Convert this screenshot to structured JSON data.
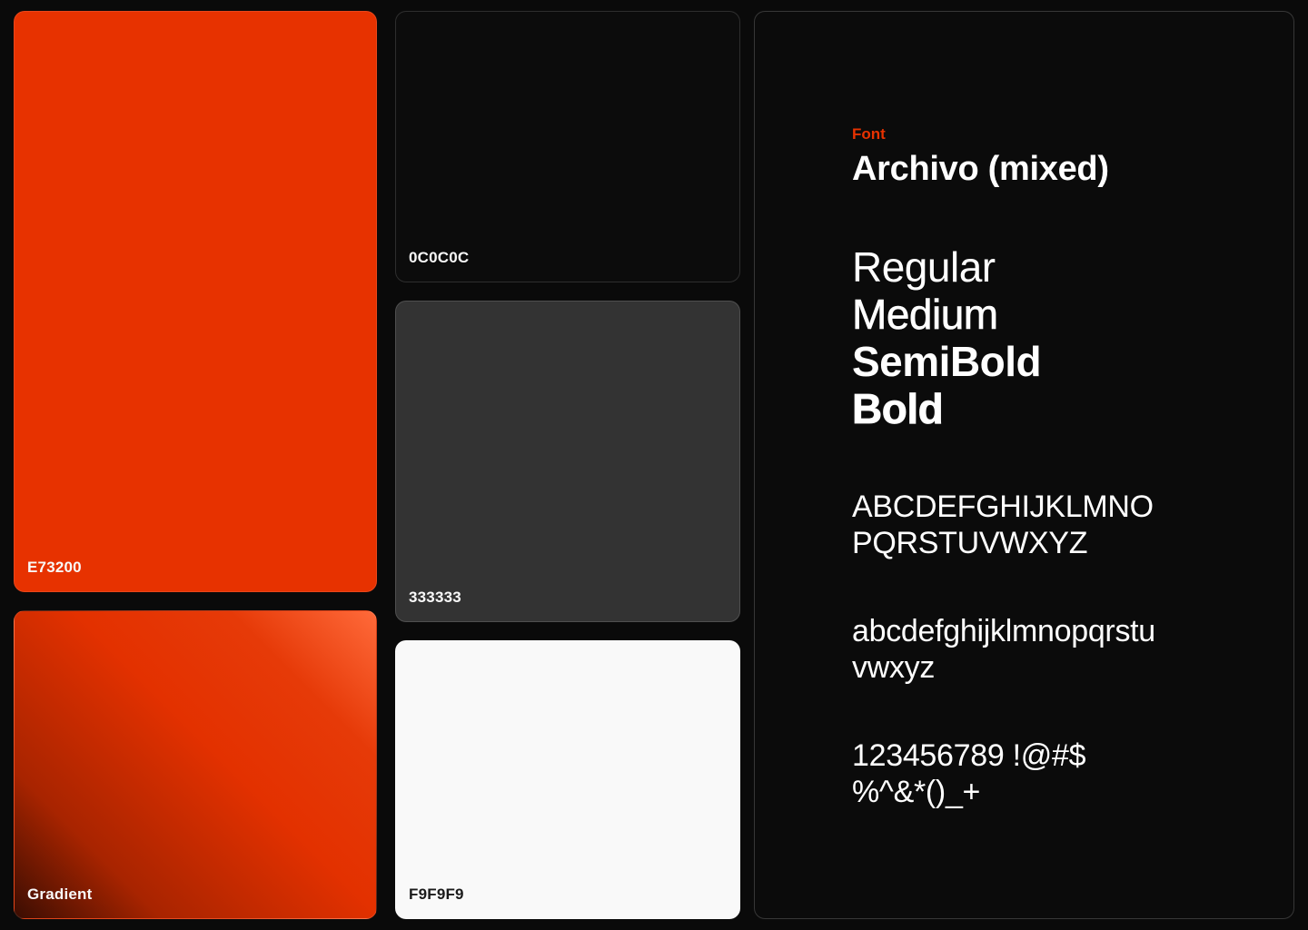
{
  "swatches": {
    "orange": {
      "label": "E73200",
      "color": "#e73200"
    },
    "gradient": {
      "label": "Gradient"
    },
    "black": {
      "label": "0C0C0C",
      "color": "#0c0c0c"
    },
    "gray": {
      "label": "333333",
      "color": "#333333"
    },
    "white": {
      "label": "F9F9F9",
      "color": "#f9f9f9"
    }
  },
  "font": {
    "caption": "Font",
    "name": "Archivo (mixed)",
    "weights": [
      "Regular",
      "Medium",
      "SemiBold",
      "Bold"
    ],
    "uppercase": [
      "ABCDEFGHIJKLMNO",
      "PQRSTUVWXYZ"
    ],
    "lowercase": [
      "abcdefghijklmnopqrstu",
      "vwxyz"
    ],
    "numerals": [
      "123456789 !@#$",
      "%^&*()_+"
    ]
  },
  "colors": {
    "accent": "#e73200",
    "background": "#0a0a0a"
  }
}
